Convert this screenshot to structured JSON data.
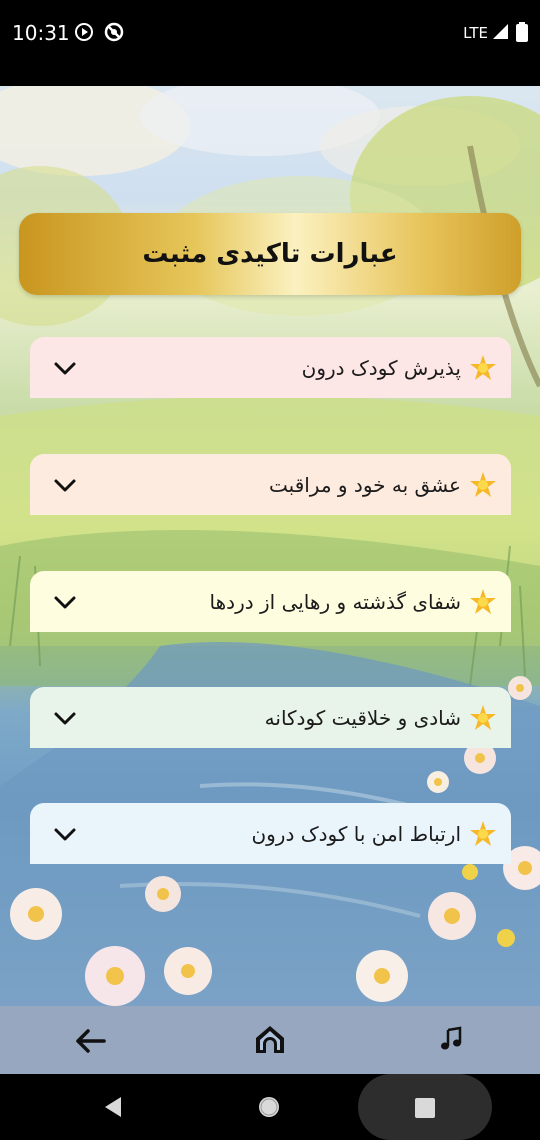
{
  "status_bar": {
    "time": "10:31",
    "network": "LTE"
  },
  "header": {
    "title": "عبارات تاکیدی مثبت"
  },
  "accordion": [
    {
      "label": "پذیرش کودک درون",
      "bg": "#fde6e6",
      "icon": "sun-star-icon"
    },
    {
      "label": "عشق به خود و مراقبت",
      "bg": "#fdebe0",
      "icon": "sun-star-icon"
    },
    {
      "label": "شفای گذشته و رهایی از دردها",
      "bg": "#fefde0",
      "icon": "sun-star-icon"
    },
    {
      "label": "شادی و خلاقیت کودکانه",
      "bg": "#e8f4ea",
      "icon": "sun-star-icon"
    },
    {
      "label": "ارتباط امن با کودک درون",
      "bg": "#eaf4fb",
      "icon": "sun-star-icon"
    }
  ],
  "bottom_nav": {
    "items": [
      "back-arrow-icon",
      "home-icon",
      "music-note-icon"
    ]
  },
  "system_nav": {
    "items": [
      "back-triangle-icon",
      "home-circle-icon",
      "recents-square-icon"
    ]
  }
}
